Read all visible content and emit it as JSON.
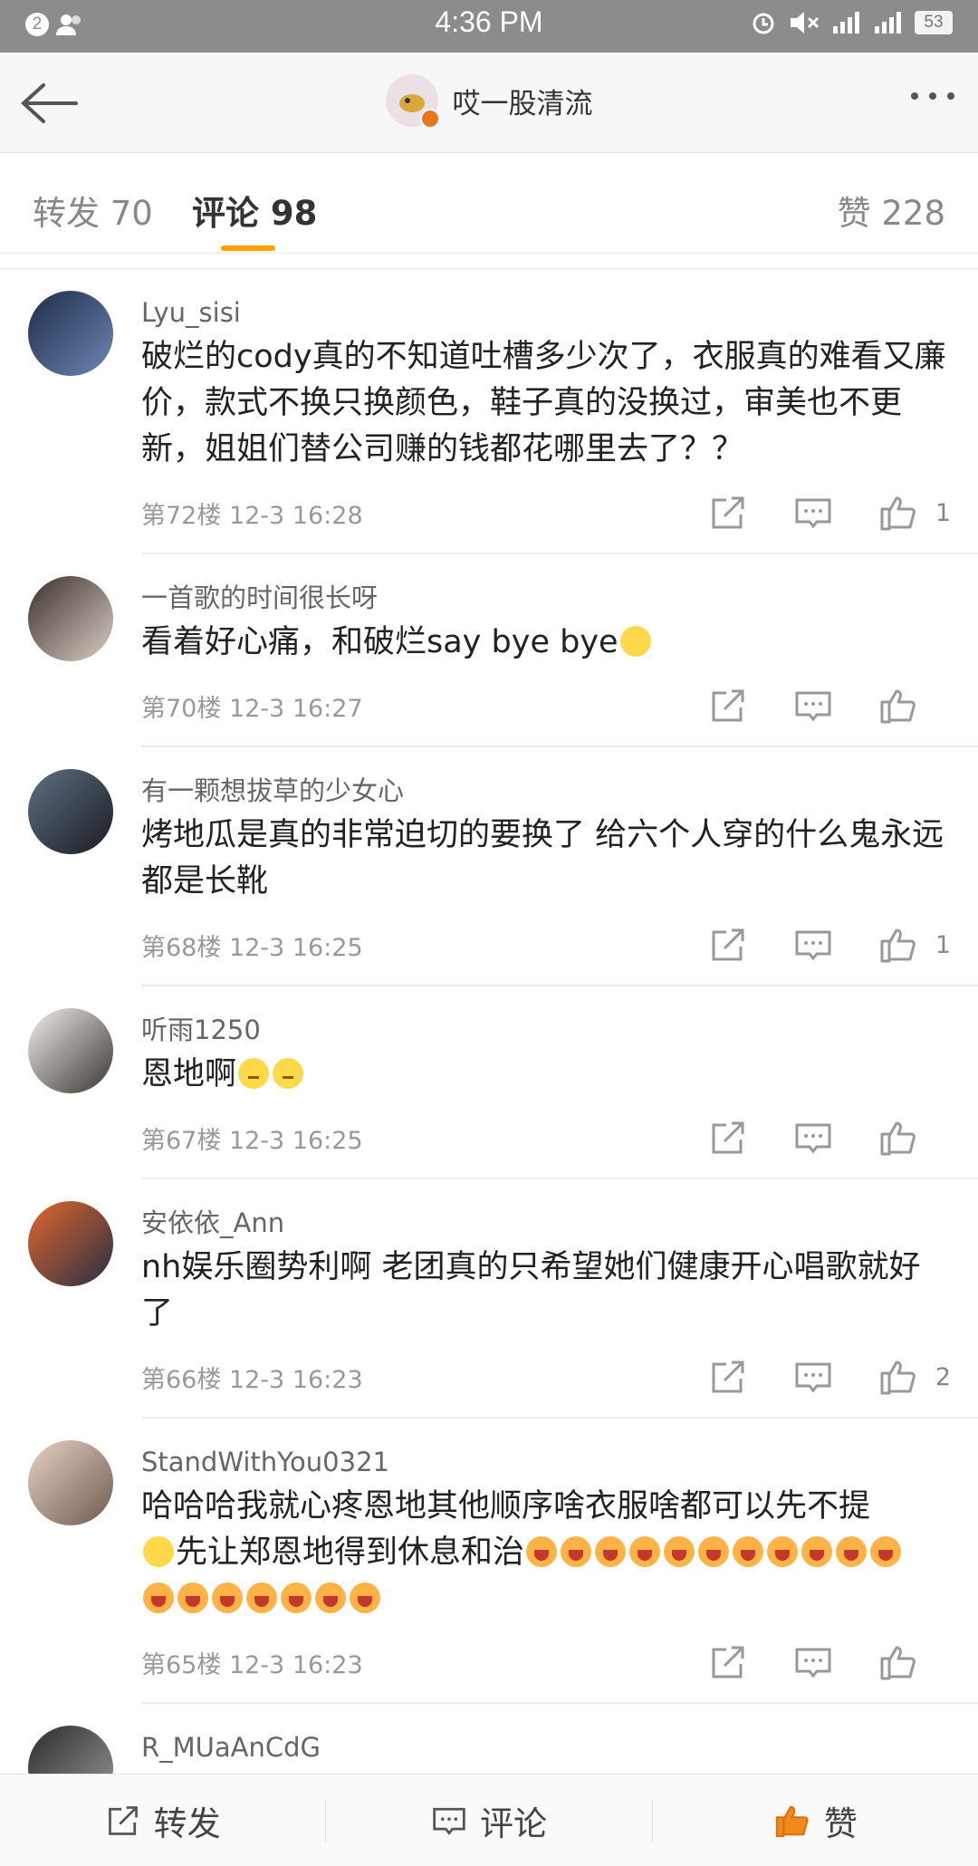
{
  "status_bar": {
    "time": "4:36 PM",
    "notification_count": "2",
    "battery": "53"
  },
  "header": {
    "title": "哎一股清流"
  },
  "tabs": {
    "repost": "转发 70",
    "comment": "评论 98",
    "like": "赞 228"
  },
  "comments": [
    {
      "user": "Lyu_sisi",
      "text": "破烂的cody真的不知道吐槽多少次了，衣服真的难看又廉价，款式不换只换颜色，鞋子真的没换过，审美也不更新，姐姐们替公司赚的钱都花哪里去了？？",
      "floor": "第72楼",
      "time": "12-3 16:28",
      "likes": "1"
    },
    {
      "user": "一首歌的时间很长呀",
      "text": "看着好心痛，和破烂say bye bye",
      "floor": "第70楼",
      "time": "12-3 16:27",
      "likes": ""
    },
    {
      "user": "有一颗想拔草的少女心",
      "text": "烤地瓜是真的非常迫切的要换了 给六个人穿的什么鬼永远都是长靴",
      "floor": "第68楼",
      "time": "12-3 16:25",
      "likes": "1"
    },
    {
      "user": "听雨1250",
      "text": "恩地啊",
      "floor": "第67楼",
      "time": "12-3 16:25",
      "likes": ""
    },
    {
      "user": "安依依_Ann",
      "text": "nh娱乐圈势利啊 老团真的只希望她们健康开心唱歌就好了",
      "floor": "第66楼",
      "time": "12-3 16:23",
      "likes": "2"
    },
    {
      "user": "StandWithYou0321",
      "text1": "哈哈哈我就心疼恩地其他顺序啥衣服啥都可以先不提",
      "text2": "先让郑恩地得到休息和治",
      "floor": "第65楼",
      "time": "12-3 16:23",
      "likes": ""
    },
    {
      "user": "R_MUaAnCdG"
    }
  ],
  "bottom_bar": {
    "repost": "转发",
    "comment": "评论",
    "like": "赞"
  },
  "colors": {
    "accent": "#ffa200",
    "like_orange": "#f08a1d"
  }
}
